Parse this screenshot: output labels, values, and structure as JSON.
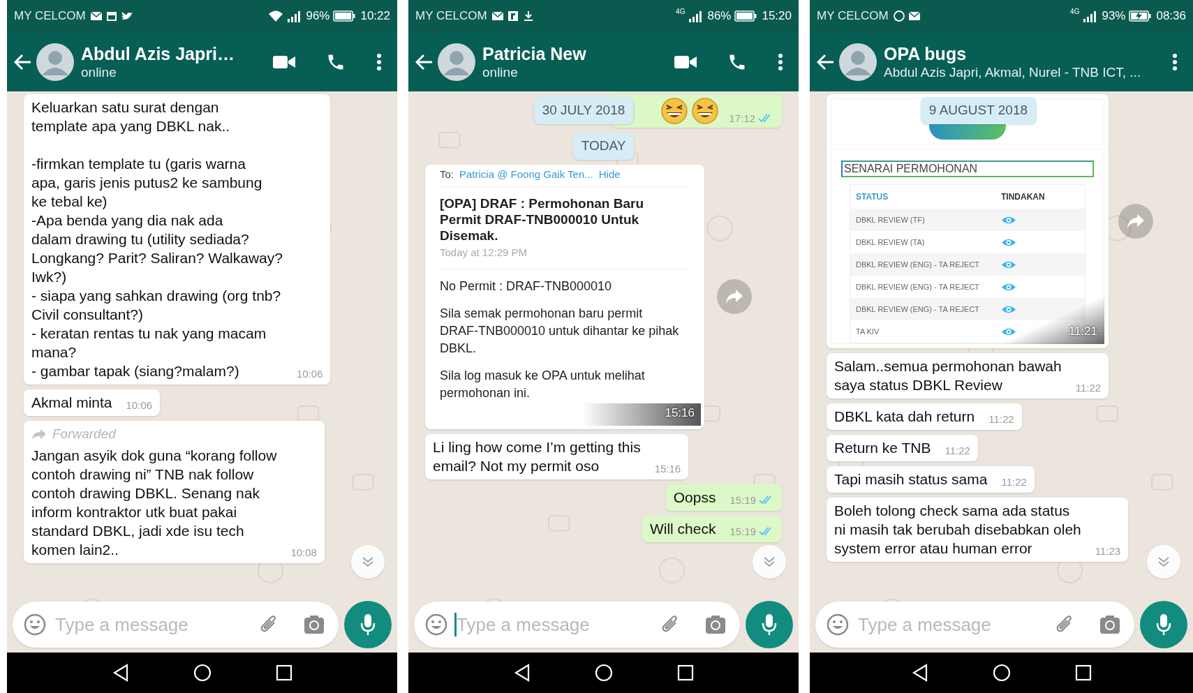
{
  "phones": [
    {
      "status_bar": {
        "carrier": "MY CELCOM",
        "notifications": [
          {
            "kind": "mail"
          },
          {
            "kind": "calendar"
          },
          {
            "kind": "bird"
          }
        ],
        "connection": {
          "kind": "wifi"
        },
        "battery": "96%",
        "charging": false,
        "time": "10:22"
      },
      "header": {
        "title": "Abdul Azis Japri…",
        "subtitle": "online",
        "actions": [
          {
            "kind": "video"
          },
          {
            "kind": "call"
          },
          {
            "kind": "menu"
          }
        ]
      },
      "messages": [
        {
          "kind": "text",
          "outgoing": false,
          "text": "Keluarkan satu surat dengan\ntemplate apa yang DBKL nak..\n\n-firmkan template tu (garis warna\napa, garis jenis putus2 ke sambung\nke tebal ke)\n-Apa benda yang dia nak ada\ndalam drawing tu (utility sediada?\nLongkang? Parit? Saliran? Walkaway?\nIwk?)\n- siapa yang sahkan drawing (org tnb?\nCivil consultant?)\n- keratan rentas tu nak yang macam\nmana?\n- gambar tapak (siang?malam?)",
          "time": "10:06"
        },
        {
          "kind": "text",
          "outgoing": false,
          "text": "Akmal minta",
          "time": "10:06"
        },
        {
          "kind": "text",
          "outgoing": false,
          "forwarded_label": "Forwarded",
          "text": "Jangan asyik dok guna “korang follow\ncontoh drawing ni” TNB nak follow\ncontoh drawing DBKL. Senang nak\ninform kontraktor utk buat pakai\nstandard DBKL, jadi xde isu tech\nkomen lain2..",
          "time": "10:08"
        }
      ],
      "scroll_button": true,
      "input": {
        "placeholder": "Type a message",
        "focused": false
      }
    },
    {
      "status_bar": {
        "carrier": "MY CELCOM",
        "notifications": [
          {
            "kind": "mail"
          },
          {
            "kind": "square"
          },
          {
            "kind": "download"
          }
        ],
        "connection": {
          "kind": "cellular",
          "label": "4G"
        },
        "battery": "86%",
        "charging": false,
        "time": "15:20"
      },
      "header": {
        "title": "Patricia New",
        "subtitle": "online",
        "actions": [
          {
            "kind": "video"
          },
          {
            "kind": "call"
          },
          {
            "kind": "menu"
          }
        ]
      },
      "floating_date": "30 JULY 2018",
      "messages": [
        {
          "kind": "laugh_emoji",
          "outgoing": true,
          "time": "17:12",
          "read": true
        },
        {
          "kind": "date",
          "text": "TODAY"
        },
        {
          "kind": "email_screenshot",
          "outgoing": false,
          "forward": true,
          "to_label": "To:",
          "to_value": "Patricia @ Foong Gaik Ten...",
          "hide_link": "Hide",
          "subject": "[OPA] DRAF : Permohonan Baru Permit DRAF-TNB000010 Untuk Disemak.",
          "sent": "Today at 12:29 PM",
          "paragraphs": [
            "No Permit : DRAF-TNB000010",
            "Sila semak permohonan baru permit DRAF-TNB000010 untuk dihantar ke pihak DBKL.",
            "Sila log masuk ke OPA untuk melihat permohonan ini."
          ],
          "time": "15:16"
        },
        {
          "kind": "text",
          "outgoing": false,
          "text": "Li ling how come I’m getting this\nemail? Not my permit oso",
          "time": "15:16"
        },
        {
          "kind": "text",
          "outgoing": true,
          "text": "Oopss",
          "time": "15:19",
          "read": true
        },
        {
          "kind": "text",
          "outgoing": true,
          "text": "Will check",
          "time": "15:19",
          "read": true
        }
      ],
      "scroll_button": true,
      "input": {
        "placeholder": "Type a message",
        "focused": true
      }
    },
    {
      "status_bar": {
        "carrier": "MY CELCOM",
        "notifications": [
          {
            "kind": "chat"
          },
          {
            "kind": "mail"
          }
        ],
        "connection": {
          "kind": "cellular",
          "label": "4G"
        },
        "battery": "93%",
        "charging": true,
        "time": "08:36"
      },
      "header": {
        "title": "OPA bugs",
        "subtitle": "Abdul Azis Japri, Akmal, Nurel - TNB ICT, ...",
        "actions": [
          {
            "kind": "menu"
          }
        ]
      },
      "floating_date": "9 AUGUST 2018",
      "messages": [
        {
          "kind": "table_screenshot",
          "outgoing": false,
          "forward": true,
          "title": "SENARAI PERMOHONAN",
          "columns": [
            "STATUS",
            "TINDAKAN"
          ],
          "rows": [
            "DBKL REVIEW (TF)",
            "DBKL REVIEW (TA)",
            "DBKL REVIEW (ENG) - TA REJECT",
            "DBKL REVIEW (ENG) - TA REJECT",
            "DBKL REVIEW (ENG) - TA REJECT",
            "TA KIV"
          ],
          "time": "11:21"
        },
        {
          "kind": "text",
          "outgoing": false,
          "text": "Salam..semua permohonan bawah\nsaya status DBKL Review",
          "time": "11:22"
        },
        {
          "kind": "text",
          "outgoing": false,
          "text": "DBKL kata dah return",
          "time": "11:22"
        },
        {
          "kind": "text",
          "outgoing": false,
          "text": "Return ke TNB",
          "time": "11:22"
        },
        {
          "kind": "text",
          "outgoing": false,
          "text": "Tapi masih status sama",
          "time": "11:22"
        },
        {
          "kind": "text",
          "outgoing": false,
          "text": "Boleh tolong check sama ada status\nni masih tak berubah disebabkan oleh\nsystem error atau human error",
          "time": "11:23"
        }
      ],
      "scroll_button": true,
      "input": {
        "placeholder": "Type a message",
        "focused": false
      }
    }
  ]
}
